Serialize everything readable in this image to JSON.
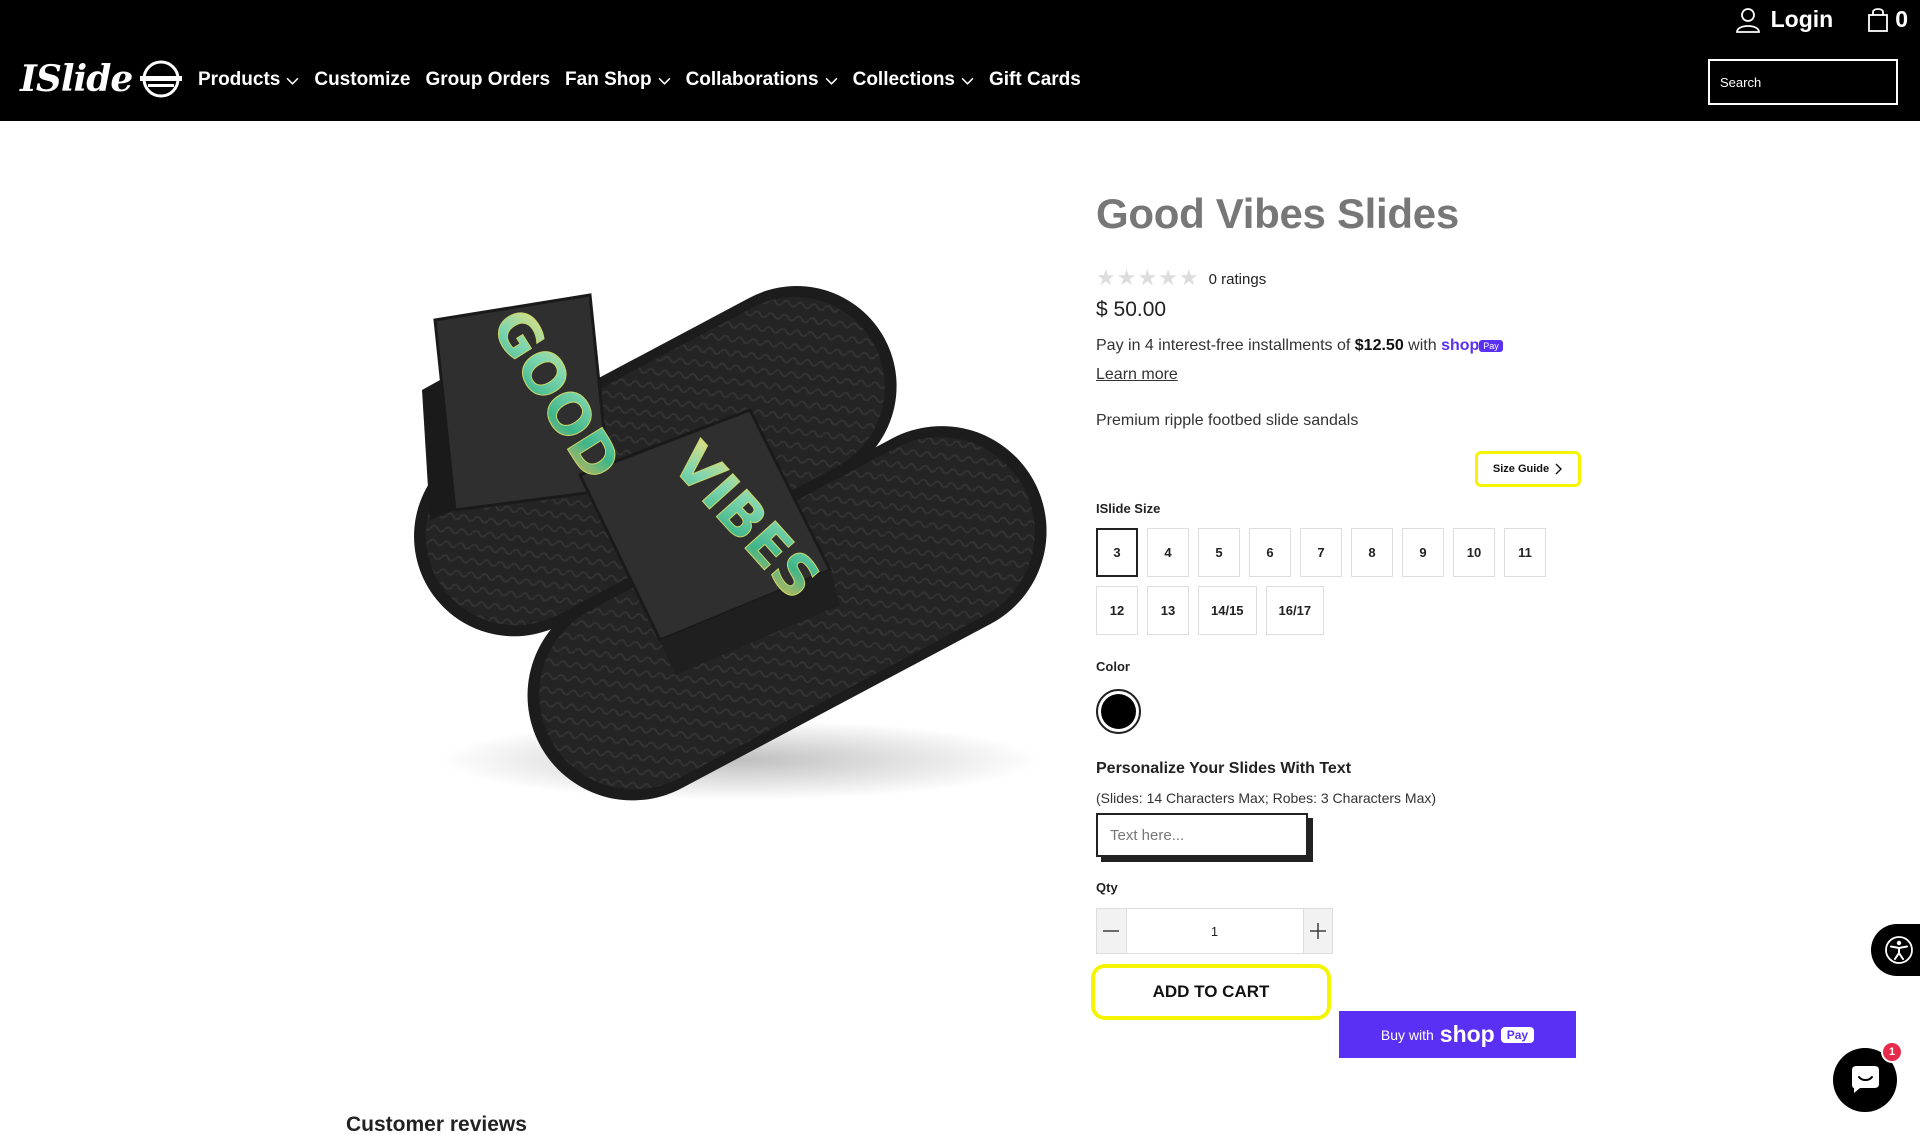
{
  "header": {
    "logo_text": "ISlide",
    "nav": [
      {
        "label": "Products",
        "has_dropdown": true
      },
      {
        "label": "Customize",
        "has_dropdown": false
      },
      {
        "label": "Group Orders",
        "has_dropdown": false
      },
      {
        "label": "Fan Shop",
        "has_dropdown": true
      },
      {
        "label": "Collaborations",
        "has_dropdown": true
      },
      {
        "label": "Collections",
        "has_dropdown": true
      },
      {
        "label": "Gift Cards",
        "has_dropdown": false
      }
    ],
    "login_label": "Login",
    "cart_count": "0",
    "search_placeholder": "Search"
  },
  "product": {
    "title": "Good Vibes Slides",
    "rating_text": "0 ratings",
    "rating_value": 0,
    "price": "$ 50.00",
    "installments": {
      "prefix": "Pay in 4 interest-free installments of ",
      "amount": "$12.50",
      "suffix": " with ",
      "brand": "shop",
      "badge": "Pay"
    },
    "learn_more": "Learn more",
    "description": "Premium ripple footbed slide sandals",
    "size_guide_label": "Size Guide",
    "size_label": "ISlide Size",
    "sizes": [
      "3",
      "4",
      "5",
      "6",
      "7",
      "8",
      "9",
      "10",
      "11",
      "12",
      "13",
      "14/15",
      "16/17"
    ],
    "selected_size": "3",
    "color_label": "Color",
    "color_selected": "#000000",
    "personalize_title": "Personalize Your Slides With Text",
    "personalize_sub": "(Slides: 14 Characters Max; Robes: 3 Characters Max)",
    "text_placeholder": "Text here...",
    "qty_label": "Qty",
    "qty_value": "1",
    "add_to_cart": "ADD TO CART",
    "shop_pay": {
      "prefix": "Buy with",
      "brand": "shop",
      "badge": "Pay"
    },
    "image_text": {
      "word1": "GOOD",
      "word2": "VIBES"
    }
  },
  "widgets": {
    "chat_badge": "1"
  },
  "reviews_title": "Customer reviews",
  "colors": {
    "header_bg": "#000000",
    "highlight": "#f5f500",
    "shop_pay": "#5a31f4",
    "title_gray": "#777777"
  }
}
